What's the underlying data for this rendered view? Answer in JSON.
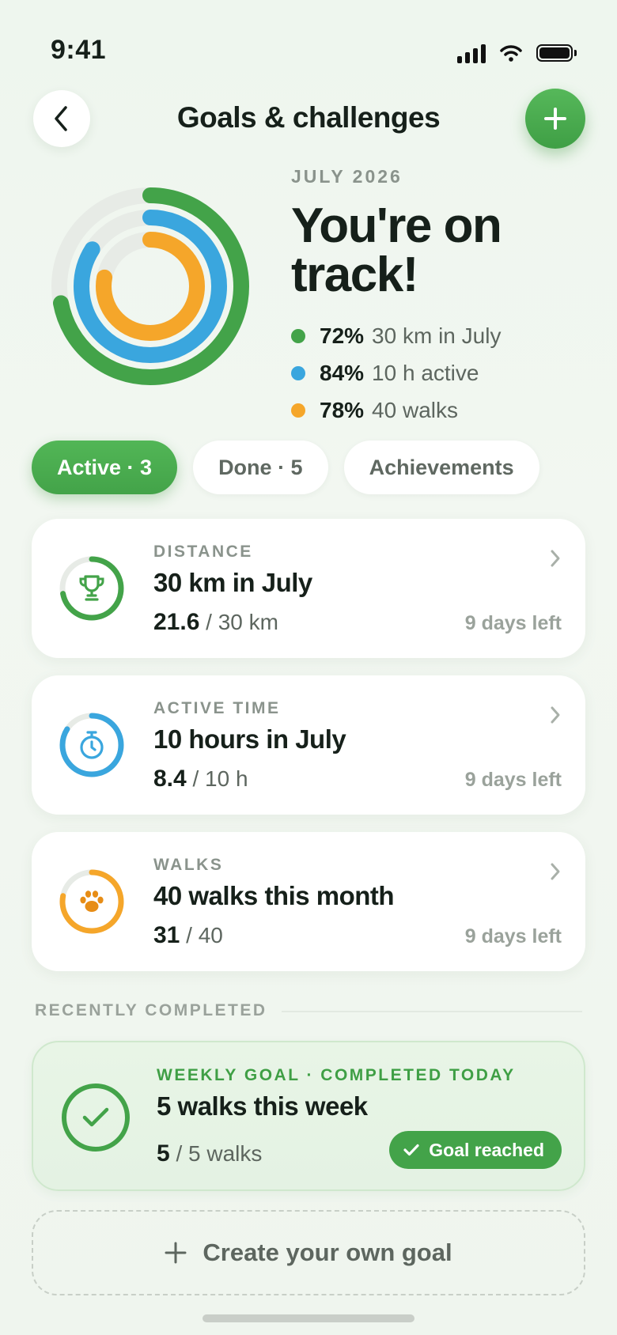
{
  "status": {
    "time": "9:41"
  },
  "header": {
    "title": "Goals & challenges"
  },
  "summary": {
    "month": "JULY 2026",
    "headline_line1": "You're on",
    "headline_line2": "track!",
    "legend": [
      {
        "pct": "72%",
        "label": "30 km in July",
        "color": "#43a349",
        "fraction": 0.72
      },
      {
        "pct": "84%",
        "label": "10 h active",
        "color": "#3aa6de",
        "fraction": 0.84
      },
      {
        "pct": "78%",
        "label": "40 walks",
        "color": "#f5a62a",
        "fraction": 0.78
      }
    ]
  },
  "tabs": [
    {
      "label": "Active · 3"
    },
    {
      "label": "Done · 5"
    },
    {
      "label": "Achievements"
    }
  ],
  "goals": [
    {
      "category": "DISTANCE",
      "title": "30 km in July",
      "current": "21.6",
      "target": "/ 30 km",
      "days_left": "9 days left",
      "icon": "trophy-icon",
      "color": "#43a349",
      "fraction": 0.72
    },
    {
      "category": "ACTIVE TIME",
      "title": "10 hours in July",
      "current": "8.4",
      "target": "/ 10 h",
      "days_left": "9 days left",
      "icon": "stopwatch-icon",
      "color": "#3aa6de",
      "fraction": 0.84
    },
    {
      "category": "WALKS",
      "title": "40 walks this month",
      "current": "31",
      "target": "/ 40",
      "days_left": "9 days left",
      "icon": "paw-icon",
      "color": "#f5a62a",
      "fraction": 0.78
    }
  ],
  "recent": {
    "section_label": "RECENTLY COMPLETED",
    "category": "WEEKLY GOAL · COMPLETED TODAY",
    "title": "5 walks this week",
    "current": "5",
    "target": "/ 5 walks",
    "badge": "Goal reached"
  },
  "create": {
    "label": "Create your own goal"
  },
  "colors": {
    "accent": "#43a349",
    "track": "#e7ebe6"
  }
}
